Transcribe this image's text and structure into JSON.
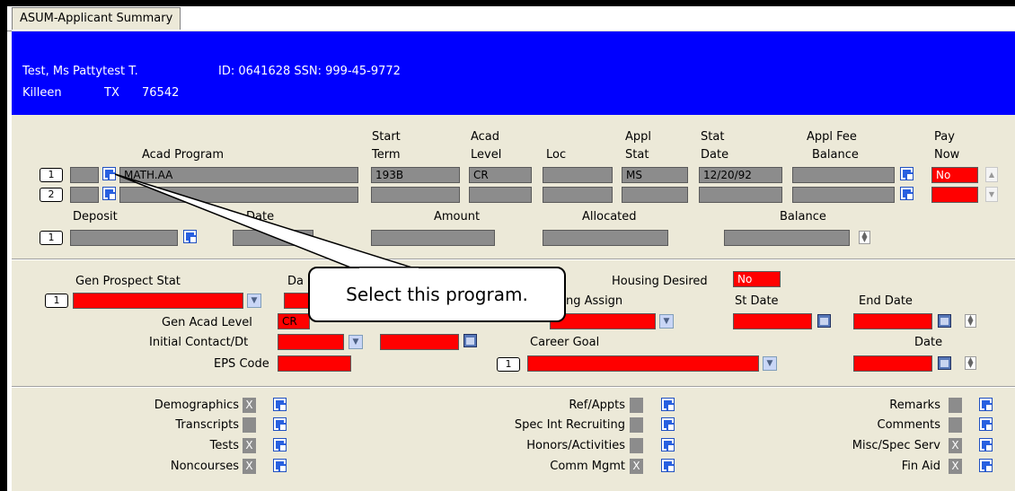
{
  "tab": {
    "title": "ASUM-Applicant Summary"
  },
  "header": {
    "name": "Test, Ms Pattytest T.",
    "id_ssn": "ID: 0641628 SSN: 999-45-9772",
    "city": "Killeen",
    "state": "TX",
    "zip": "76542"
  },
  "programs": {
    "headers": {
      "acad_program": "Acad Program",
      "start_term_1": "Start",
      "start_term_2": "Term",
      "acad_level_1": "Acad",
      "acad_level_2": "Level",
      "loc": "Loc",
      "appl_stat_1": "Appl",
      "appl_stat_2": "Stat",
      "stat_date_1": "Stat",
      "stat_date_2": "Date",
      "appl_fee_1": "Appl Fee",
      "appl_fee_2": "Balance",
      "pay_now_1": "Pay",
      "pay_now_2": "Now"
    },
    "rows": [
      {
        "num": "1",
        "program": "MATH.AA",
        "term": "193B",
        "level": "CR",
        "loc": "",
        "stat": "MS",
        "date": "12/20/92",
        "fee": "",
        "pay": "No"
      },
      {
        "num": "2",
        "program": "",
        "term": "",
        "level": "",
        "loc": "",
        "stat": "",
        "date": "",
        "fee": "",
        "pay": ""
      }
    ]
  },
  "deposit": {
    "deposit_label": "Deposit",
    "date_label": "Date",
    "amount_label": "Amount",
    "allocated_label": "Allocated",
    "balance_label": "Balance",
    "row_num": "1"
  },
  "prospect": {
    "gen_prospect_stat": "Gen Prospect Stat",
    "date_label": "Da",
    "row_num": "1",
    "housing_desired_label": "Housing Desired",
    "housing_desired_value": "No",
    "housing_assign_label": "ng Assign",
    "st_date": "St Date",
    "end_date": "End Date",
    "gen_acad_level": "Gen Acad Level",
    "gen_acad_level_value": "CR",
    "initial_contact": "Initial Contact/Dt",
    "career_goal": "Career Goal",
    "career_row_num": "1",
    "date2": "Date",
    "eps_code": "EPS Code"
  },
  "links": {
    "left": [
      {
        "label": "Demographics",
        "x": "X"
      },
      {
        "label": "Transcripts",
        "x": ""
      },
      {
        "label": "Tests",
        "x": "X"
      },
      {
        "label": "Noncourses",
        "x": "X"
      }
    ],
    "middle": [
      {
        "label": "Ref/Appts",
        "x": ""
      },
      {
        "label": "Spec Int Recruiting",
        "x": ""
      },
      {
        "label": "Honors/Activities",
        "x": ""
      },
      {
        "label": "Comm Mgmt",
        "x": "X"
      }
    ],
    "right": [
      {
        "label": "Remarks",
        "x": ""
      },
      {
        "label": "Comments",
        "x": ""
      },
      {
        "label": "Misc/Spec Serv",
        "x": "X"
      },
      {
        "label": "Fin Aid",
        "x": "X"
      }
    ]
  },
  "callout": {
    "text": "Select this program."
  },
  "colors": {
    "header_bg": "#0000FF",
    "required_field": "#FF0000",
    "panel_bg": "#ECE9D8",
    "field_bg": "#8C8C8C"
  }
}
